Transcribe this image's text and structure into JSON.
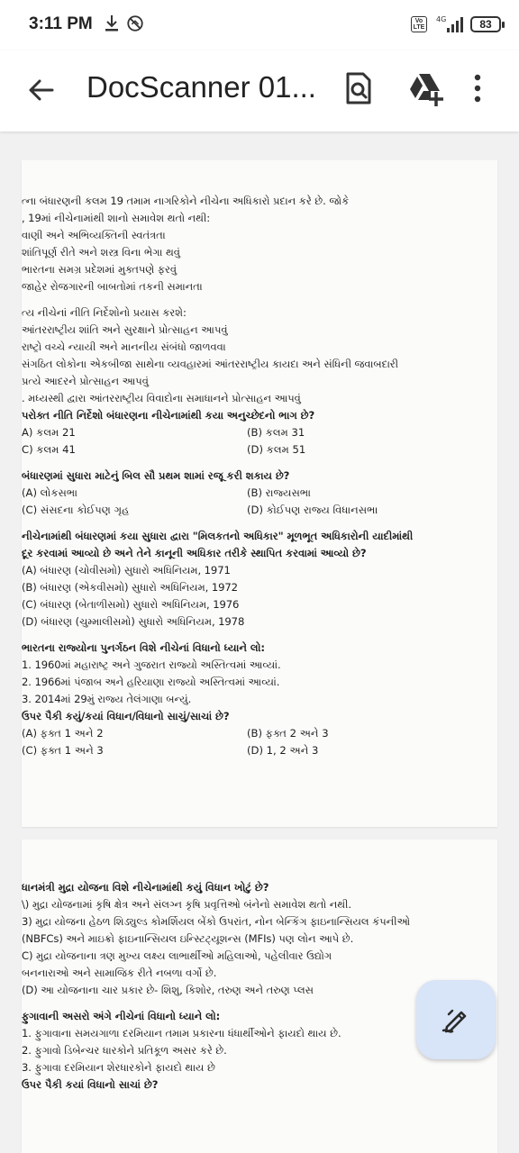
{
  "status_bar": {
    "time": "3:11 PM",
    "volte_label": "Vo LTE",
    "network_label": "4G",
    "battery": "83",
    "left_icons": [
      "download-icon",
      "dnd-off-icon"
    ]
  },
  "app_bar": {
    "title": "DocScanner 01...",
    "actions": [
      "back-arrow-icon",
      "search-document-icon",
      "google-drive-add-icon",
      "more-vert-icon"
    ]
  },
  "page1": {
    "q1_lines": [
      "ત્ના બંધારણની કલમ 19 તમામ નાગરિકોને નીચેના અધિકારો પ્રદાન કરે છે. જોકે",
      ", 19માં નીચેનામાંથી શાનો સમાવેશ થતો નથી:",
      "વાણી અને અભિવ્યક્તિની સ્વતંત્રતા",
      "શાંતિપૂર્ણ રીતે અને શસ્ત્ર વિના ભેગા થવું",
      "ભારતના સમગ્ર પ્રદેશમાં મુક્તપણે ફરવું",
      "જાહેર રોજગારની બાબતોમાં તકની સમાનતા"
    ],
    "q2_lines": [
      "ત્ય નીચેનાં નીતિ નિર્દેશોનો પ્રયાસ કરશે:",
      "આંતરરાષ્ટ્રીય શાંતિ અને સુરક્ષાને પ્રોત્સાહન આપવું",
      "રાષ્ટ્રો વચ્ચે ન્યાયી અને માનનીય સંબંધો જાળવવા",
      "સંગઠિત લોકોના એકબીજા સાથેના વ્યવહારમાં આંતરરાષ્ટ્રીય કાયદા અને સંધિની જવાબદારી",
      "પ્રત્યે આદરને પ્રોત્સાહન આપવું",
      ". મધ્યસ્થી દ્વારા આંતરરાષ્ટ્રીય વિવાદોના સમાધાનને પ્રોત્સાહન આપવું",
      "પરોક્ત નીતિ નિર્દેશો બંધારણના નીચેનામાંથી કયા અનુચ્છેદનો ભાગ છે?"
    ],
    "q2_options": [
      [
        "A) કલમ 21",
        "(B) કલમ 31"
      ],
      [
        "C) કલમ 41",
        "(D) કલમ 51"
      ]
    ],
    "q3_lines": [
      "બંધારણમાં સુધારા માટેનું બિલ સૌ પ્રથમ શામાં રજૂ કરી શકાય છે?"
    ],
    "q3_options": [
      [
        "(A) લોકસભા",
        "(B) રાજ્યસભા"
      ],
      [
        "(C) સંસદના કોઈપણ ગૃહ",
        "(D) કોઈપણ રાજ્ય વિધાનસભા"
      ]
    ],
    "q4_lines": [
      "નીચેનામાંથી બંધારણમાં કયા સુધારા દ્વારા \"મિલકતનો અધિકાર\" મૂળભૂત અધિકારોની યાદીમાંથી",
      "દૂર કરવામાં આવ્યો છે અને તેને કાનૂની અધિકાર તરીકે સ્થાપિત કરવામાં આવ્યો છે?",
      "(A) બંધારણ (ચોવીસમો) સુધારો અધિનિયમ, 1971",
      "(B) બંધારણ (એકવીસમો) સુધારો અધિનિયમ, 1972",
      "(C) બંધારણ (બેતાળીસમો) સુધારો અધિનિયમ, 1976",
      "(D) બંધારણ (ચુમ્માલીસમો) સુધારો અધિનિયમ, 1978"
    ],
    "q5_lines": [
      "ભારતના રાજ્યોના પુનર્ગઠન વિશે નીચેનાં વિધાનો ધ્યાને લો:",
      "1. 1960માં મહારાષ્ટ્ર અને ગુજરાત રાજ્યો અસ્તિત્વમાં આવ્યાં.",
      "2. 1966માં પંજાબ અને હરિયાણા રાજ્યો અસ્તિત્વમાં આવ્યાં.",
      "3. 2014માં 29મું રાજ્ય તેલંગાણા બન્યું.",
      "ઉપર પૈકી કયું/કયાં વિધાન/વિધાનો સાચું/સાચાં છે?"
    ],
    "q5_options": [
      [
        "(A) ફક્ત 1 અને 2",
        "(B) ફક્ત 2 અને 3"
      ],
      [
        "(C) ફક્ત 1 અને 3",
        "(D) 1, 2 અને 3"
      ]
    ]
  },
  "page2": {
    "q6_lines": [
      "ધાનમંત્રી મુદ્રા યોજના વિશે નીચેનામાંથી કયું વિધાન ખોટું છે?",
      "\\) મુદ્રા યોજનામાં કૃષિ ક્ષેત્ર અને સંલગ્ન કૃષિ પ્રવૃત્તિઓ બંનેનો સમાવેશ થતો નથી.",
      "3) મુદ્રા યોજના હેઠળ શિડ્યુલ્ડ કોમર્શિયલ બેંકો ઉપરાંત, નોન બેન્કિંગ ફાઇનાન્સિયલ કંપનીઓ",
      "(NBFCs) અને માઇક્રો ફાઇનાન્સિયલ ઇન્સ્ટિટ્યૂશન્સ (MFIs) પણ લોન આપે છે.",
      "C) મુદ્રા યોજનાના ત્રણ મુખ્ય લક્ષ્ય લાભાર્થીઓ મહિલાઓ, પહેલીવાર ઉદ્યોગ",
      "બનનારાઓ અને સામાજિક રીતે નબળા વર્ગો છે.",
      "(D) આ યોજનાના ચાર પ્રકાર છે- શિશુ, કિશોર, તરુણ અને તરુણ પ્લસ"
    ],
    "q7_lines": [
      "ફુગાવાની અસરો અંગે નીચેનાં વિધાનો ધ્યાને લો:",
      "1. ફુગાવાના સમયગાળા દરમિયાન તમામ પ્રકારના ધંધાર્થીઓને ફાયદો થાય છે.",
      "2. ફુગાવો ડિબેન્ચર ધારકોને પ્રતિકૂળ અસર કરે છે.",
      "3. ફુગાવા દરમિયાન શેરધારકોને ફાયદો થાય છે",
      "ઉપર પૈકી કયાં વિધાનો સાચાં છે?"
    ]
  },
  "fab": {
    "icon": "edit-pen-icon"
  }
}
